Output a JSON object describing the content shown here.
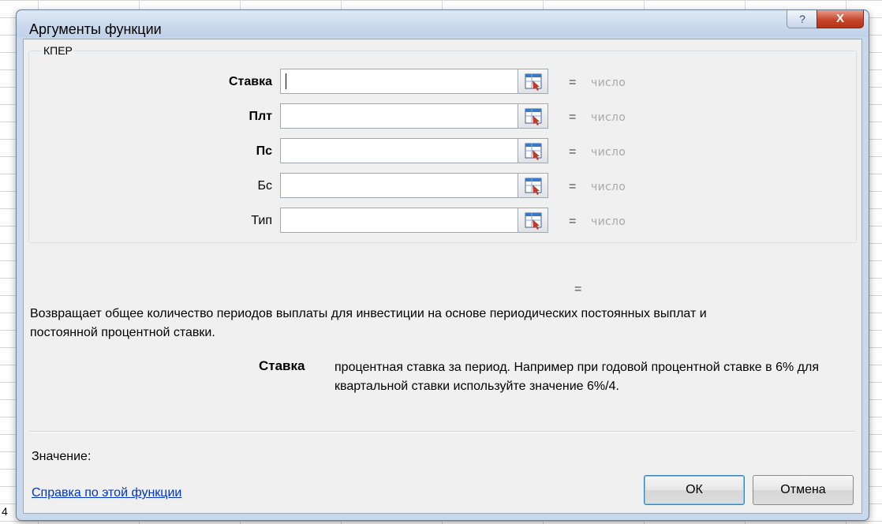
{
  "sheet": {
    "partial_cell_text": "4"
  },
  "dialog": {
    "title": "Аргументы функции",
    "help_button_label": "?",
    "close_button_label": "X"
  },
  "function": {
    "name": "КПЕР",
    "arguments": [
      {
        "label": "Ставка",
        "bold": true,
        "value": "",
        "hint": "число"
      },
      {
        "label": "Плт",
        "bold": true,
        "value": "",
        "hint": "число"
      },
      {
        "label": "Пс",
        "bold": true,
        "value": "",
        "hint": "число"
      },
      {
        "label": "Бс",
        "bold": false,
        "value": "",
        "hint": "число"
      },
      {
        "label": "Тип",
        "bold": false,
        "value": "",
        "hint": "число"
      }
    ],
    "equals_sign": "=",
    "result_equals": "=",
    "description": "Возвращает общее количество периодов выплаты для инвестиции на основе периодических постоянных выплат и постоянной процентной ставки.",
    "argument_help": {
      "name": "Ставка",
      "text": "процентная ставка за период. Например при годовой процентной ставке в 6% для квартальной ставки используйте значение 6%/4."
    }
  },
  "footer": {
    "value_label": "Значение:",
    "help_link": "Справка по этой функции",
    "ok_label": "ОК",
    "cancel_label": "Отмена"
  },
  "colors": {
    "dialog_frame": "#c9d9ec",
    "client_background": "#f0f0f0",
    "hint_text": "#a8a8a8",
    "link": "#0033cc",
    "close_button": "#c6452c"
  }
}
